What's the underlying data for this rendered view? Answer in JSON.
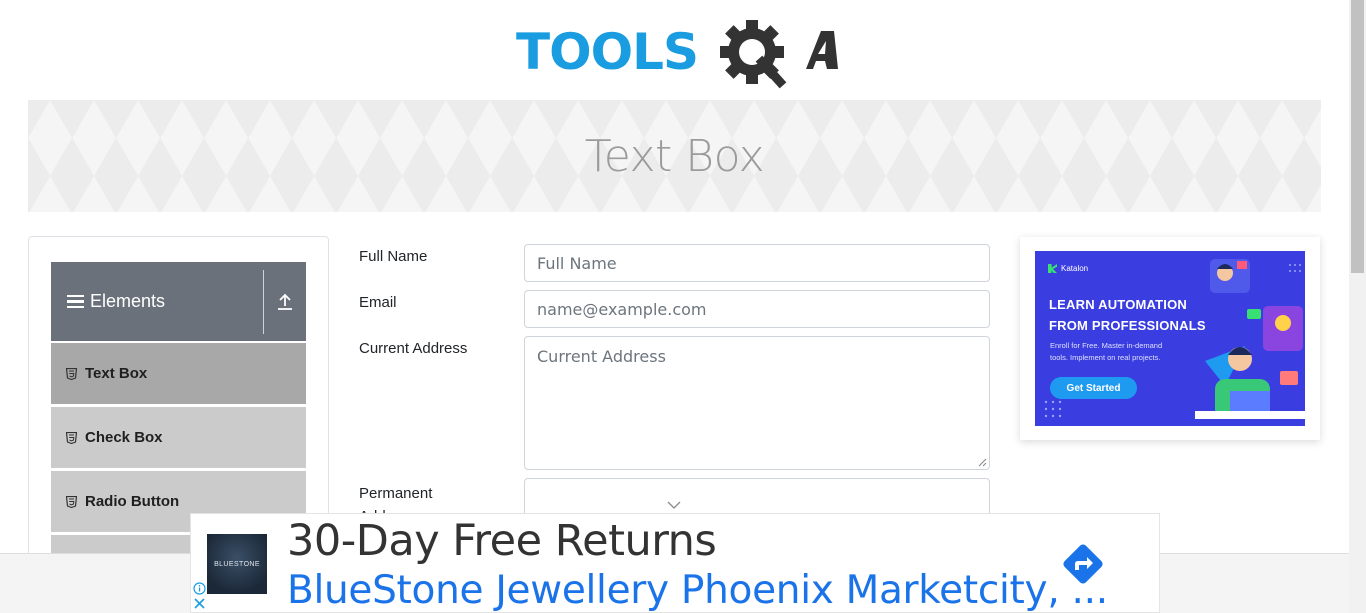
{
  "logo": {
    "text_left": "TOOLS",
    "text_right": "QA",
    "colors": {
      "brand_blue": "#1a9de0",
      "brand_dark": "#333333"
    }
  },
  "banner": {
    "title": "Text Box"
  },
  "sidebar": {
    "group_title": "Elements",
    "items": [
      {
        "label": "Text Box",
        "active": true
      },
      {
        "label": "Check Box",
        "active": false
      },
      {
        "label": "Radio Button",
        "active": false
      }
    ]
  },
  "form": {
    "full_name": {
      "label": "Full Name",
      "placeholder": "Full Name",
      "value": ""
    },
    "email": {
      "label": "Email",
      "placeholder": "name@example.com",
      "value": ""
    },
    "current_address": {
      "label": "Current Address",
      "placeholder": "Current Address",
      "value": ""
    },
    "permanent_address": {
      "label": "Permanent Address",
      "value": ""
    }
  },
  "side_ad": {
    "brand": "Katalon",
    "headline_line1": "LEARN AUTOMATION",
    "headline_line2": "FROM PROFESSIONALS",
    "subtext": "Enroll for Free. Master in-demand tools. Implement on real projects.",
    "button": "Get Started"
  },
  "bottom_ad": {
    "thumb_text": "BLUESTONE",
    "headline": "30-Day Free Returns",
    "subline": "BlueStone Jewellery Phoenix Marketcity, ..."
  }
}
